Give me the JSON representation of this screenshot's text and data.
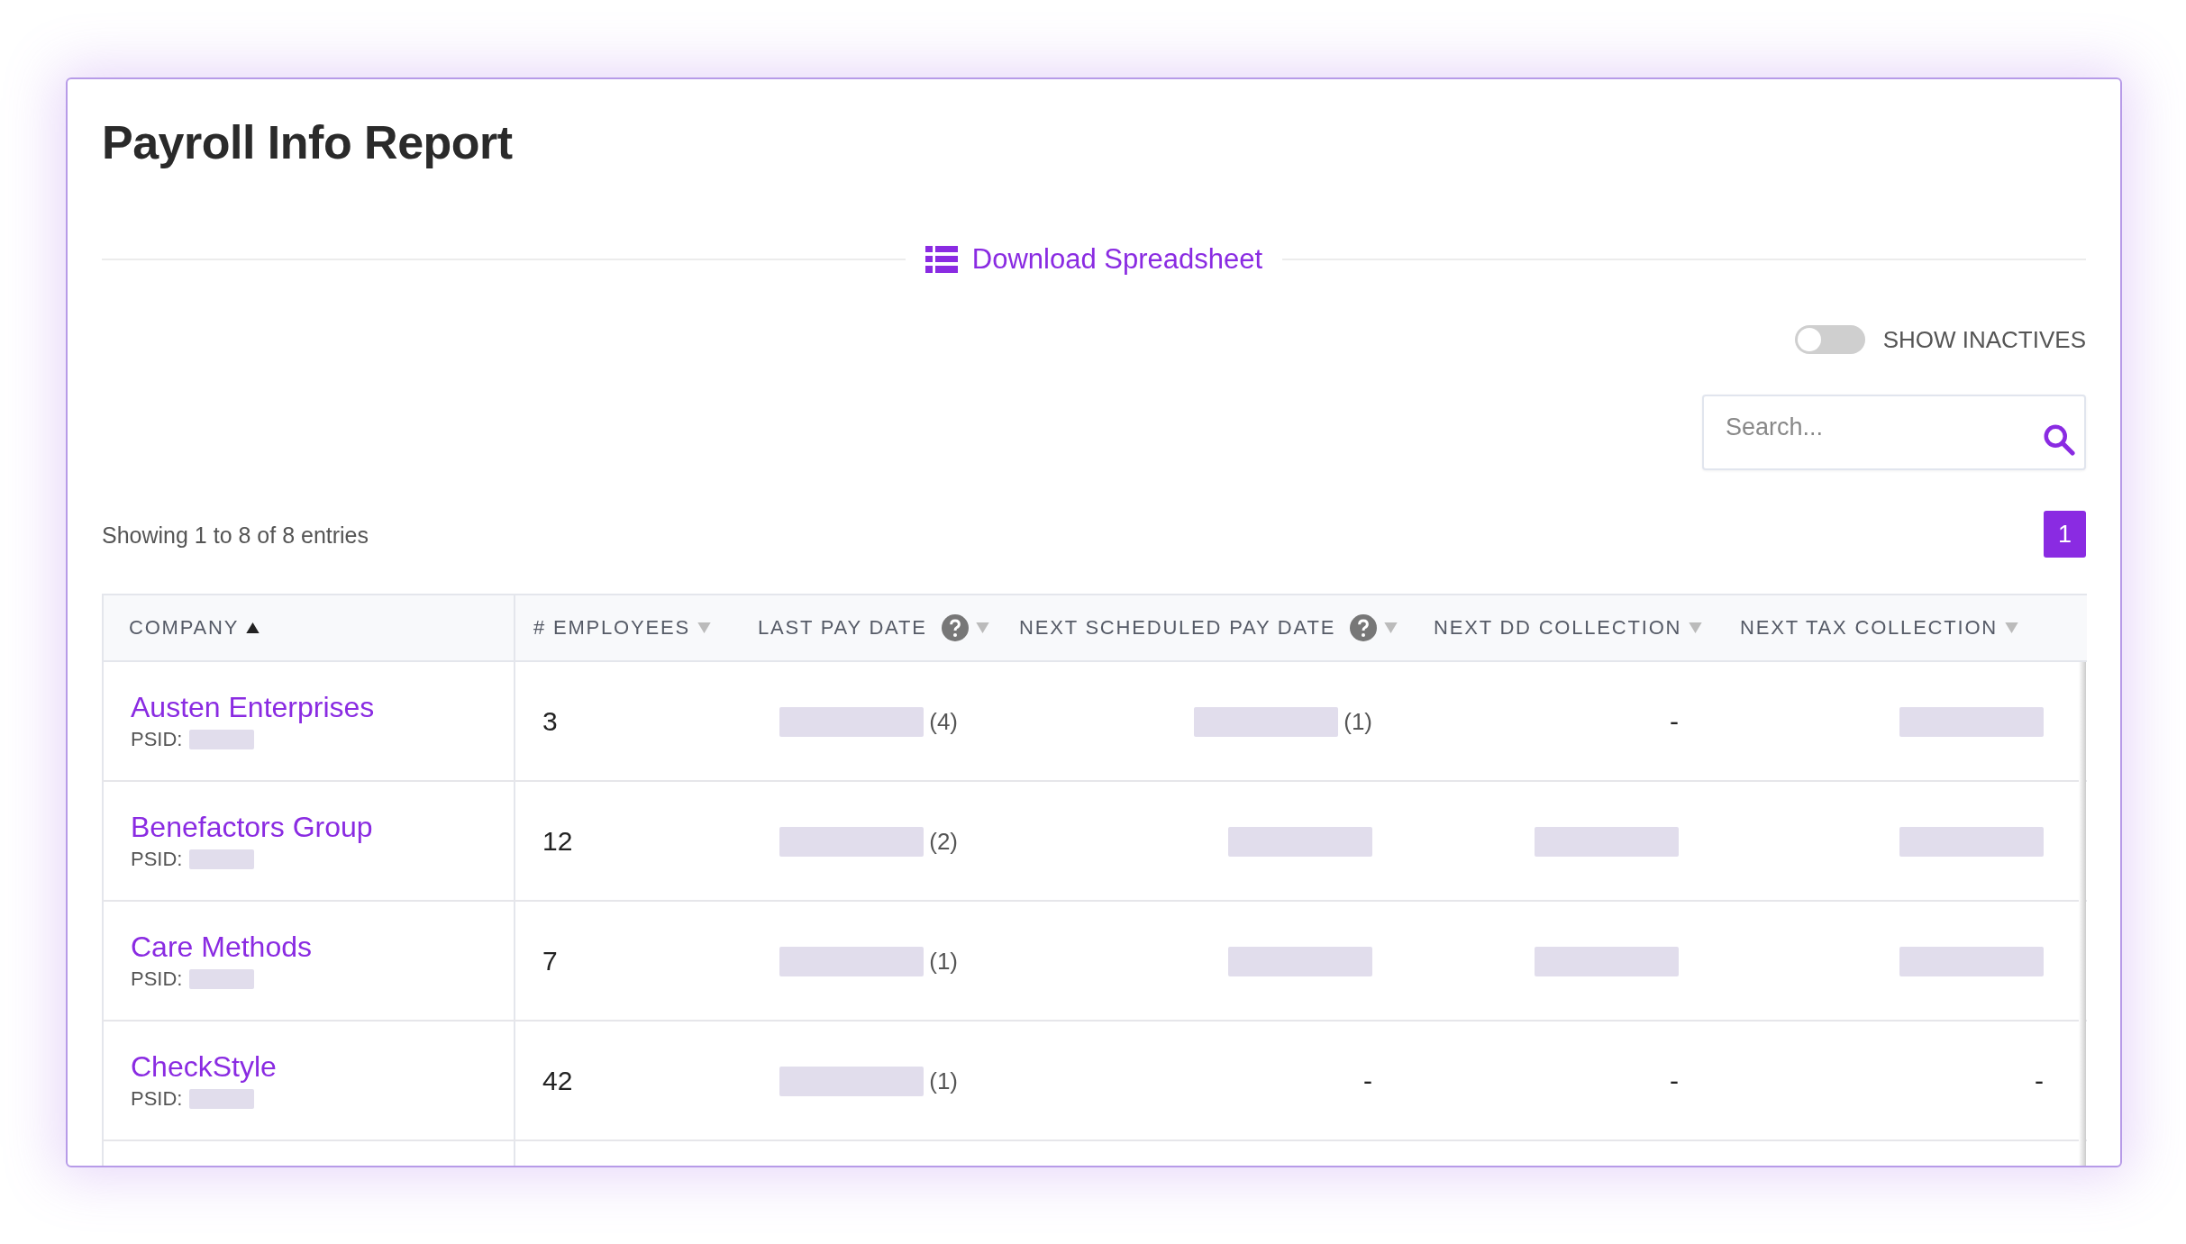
{
  "title": "Payroll Info Report",
  "download": {
    "label": "Download Spreadsheet"
  },
  "show_inactives": {
    "label": "SHOW INACTIVES",
    "on": false
  },
  "search": {
    "placeholder": "Search..."
  },
  "summary": "Showing 1 to 8 of 8 entries",
  "pagination": [
    {
      "label": "1",
      "selected": true
    }
  ],
  "table": {
    "columns": [
      {
        "label": "COMPANY",
        "sorted": true,
        "help": false
      },
      {
        "label": "# EMPLOYEES",
        "sorted": false,
        "help": false
      },
      {
        "label": "LAST PAY DATE",
        "sorted": false,
        "help": true
      },
      {
        "label": "NEXT SCHEDULED PAY DATE",
        "sorted": false,
        "help": true
      },
      {
        "label": "NEXT DD COLLECTION",
        "sorted": false,
        "help": false
      },
      {
        "label": "NEXT TAX COLLECTION",
        "sorted": false,
        "help": false
      }
    ],
    "rows": [
      {
        "cells": [
          {
            "kind": "company",
            "text": "Austen Enterprises",
            "psid_label": "PSID:"
          },
          {
            "kind": "text",
            "text": "3"
          },
          {
            "kind": "redacted",
            "count": "(4)"
          },
          {
            "kind": "redacted",
            "count": "(1)"
          },
          {
            "kind": "text",
            "text": "-"
          },
          {
            "kind": "redacted"
          }
        ]
      },
      {
        "cells": [
          {
            "kind": "company",
            "text": "Benefactors Group",
            "psid_label": "PSID:"
          },
          {
            "kind": "text",
            "text": "12"
          },
          {
            "kind": "redacted",
            "count": "(2)"
          },
          {
            "kind": "redacted"
          },
          {
            "kind": "redacted"
          },
          {
            "kind": "redacted"
          }
        ]
      },
      {
        "cells": [
          {
            "kind": "company",
            "text": "Care Methods",
            "psid_label": "PSID:"
          },
          {
            "kind": "text",
            "text": "7"
          },
          {
            "kind": "redacted",
            "count": "(1)"
          },
          {
            "kind": "redacted"
          },
          {
            "kind": "redacted"
          },
          {
            "kind": "redacted"
          }
        ]
      },
      {
        "cells": [
          {
            "kind": "company",
            "text": "CheckStyle",
            "psid_label": "PSID:"
          },
          {
            "kind": "text",
            "text": "42"
          },
          {
            "kind": "redacted",
            "count": "(1)"
          },
          {
            "kind": "text",
            "text": "-"
          },
          {
            "kind": "text",
            "text": "-"
          },
          {
            "kind": "text",
            "text": "-"
          }
        ]
      }
    ]
  }
}
